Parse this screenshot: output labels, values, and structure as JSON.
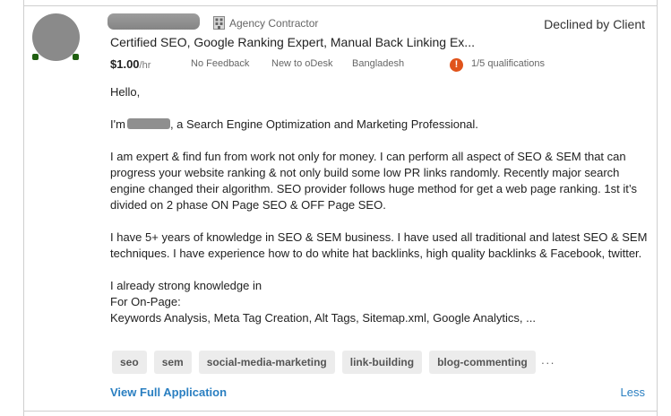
{
  "applicant": {
    "type_label": "Agency Contractor",
    "status": "Declined by Client",
    "title": "Certified SEO, Google Ranking Expert, Manual Back Linking Ex...",
    "rate_value": "$1.00",
    "rate_unit": "/hr",
    "feedback": "No Feedback",
    "tenure": "New to oDesk",
    "country": "Bangladesh",
    "warning_glyph": "!",
    "qualifications": "1/5 qualifications"
  },
  "letter": {
    "greeting": "Hello,",
    "intro_before": "I'm",
    "intro_after": ", a Search Engine Optimization and Marketing Professional.",
    "para1": "I am expert & find fun from work not only for money. I can perform all aspect of SEO & SEM that can progress your website ranking & not only build some low PR links randomly. Recently major search engine changed their algorithm.  SEO provider follows huge method for get a web page ranking.  1st it’s divided on 2 phase ON Page SEO & OFF Page SEO.",
    "para2": "I have 5+ years of knowledge in SEO & SEM business. I have used all traditional and latest SEO & SEM techniques. I have experience how to do white hat backlinks, high quality backlinks & Facebook, twitter.",
    "line_a": "I already strong knowledge in",
    "line_b": "For On-Page:",
    "line_c": "Keywords Analysis, Meta Tag Creation, Alt Tags, Sitemap.xml, Google Analytics, ..."
  },
  "tags": [
    "seo",
    "sem",
    "social-media-marketing",
    "link-building",
    "blog-commenting"
  ],
  "tags_more": "···",
  "actions": {
    "view_full": "View Full Application",
    "less": "Less"
  },
  "colors": {
    "link": "#2a7fc1",
    "warning": "#e0531b"
  },
  "icons": {
    "agency": "building-icon",
    "warning": "exclamation-circle-icon"
  }
}
